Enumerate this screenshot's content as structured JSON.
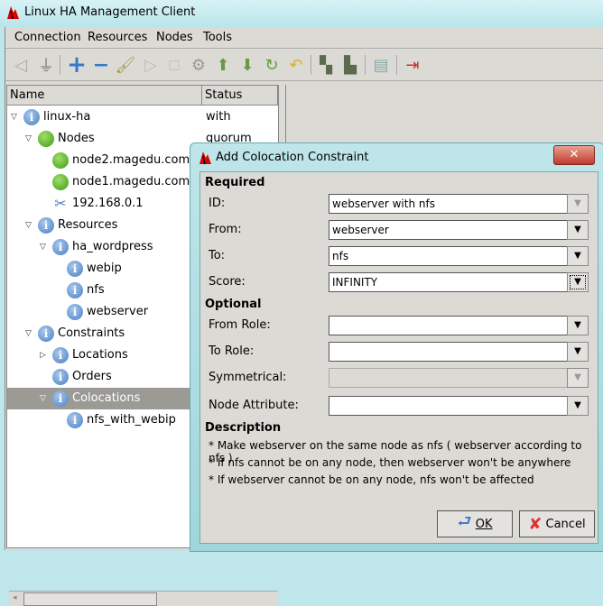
{
  "window": {
    "title": "Linux HA Management Client"
  },
  "menu": [
    "Connection",
    "Resources",
    "Nodes",
    "Tools"
  ],
  "toolbar": {
    "icons": [
      "connect-icon",
      "disconnect-icon",
      "add-icon",
      "remove-icon",
      "cleanup-icon",
      "start-icon",
      "stop-icon",
      "settings-icon",
      "up-icon",
      "down-icon",
      "redo-icon",
      "undo-icon",
      "standby-icon",
      "active-icon",
      "document-icon",
      "exit-icon"
    ]
  },
  "tree": {
    "columns": [
      "Name",
      "Status"
    ],
    "rows": [
      {
        "label": "linux-ha",
        "status": "with quorum",
        "icon": "info",
        "level": 0,
        "expander": "open"
      },
      {
        "label": "Nodes",
        "icon": "green",
        "level": 1,
        "expander": "open"
      },
      {
        "label": "node2.magedu.com",
        "icon": "green",
        "level": 2
      },
      {
        "label": "node1.magedu.com",
        "icon": "green",
        "level": 2
      },
      {
        "label": "192.168.0.1",
        "icon": "tool",
        "level": 2
      },
      {
        "label": "Resources",
        "icon": "info",
        "level": 1,
        "expander": "open"
      },
      {
        "label": "ha_wordpress",
        "icon": "info",
        "level": 2,
        "expander": "open"
      },
      {
        "label": "webip",
        "icon": "info",
        "level": 3
      },
      {
        "label": "nfs",
        "icon": "info",
        "level": 3
      },
      {
        "label": "webserver",
        "icon": "info",
        "level": 3
      },
      {
        "label": "Constraints",
        "icon": "info",
        "level": 1,
        "expander": "open"
      },
      {
        "label": "Locations",
        "icon": "info",
        "level": 2,
        "expander": "closed"
      },
      {
        "label": "Orders",
        "icon": "info",
        "level": 2
      },
      {
        "label": "Colocations",
        "icon": "info",
        "level": 2,
        "expander": "open",
        "selected": true
      },
      {
        "label": "nfs_with_webip",
        "icon": "info",
        "level": 3
      }
    ]
  },
  "dialog": {
    "title": "Add Colocation Constraint",
    "required_label": "Required",
    "optional_label": "Optional",
    "description_label": "Description",
    "fields": [
      {
        "label": "ID:",
        "value": "webserver with nfs"
      },
      {
        "label": "From:",
        "value": "webserver"
      },
      {
        "label": "To:",
        "value": "nfs"
      },
      {
        "label": "Score:",
        "value": "INFINITY"
      },
      {
        "label": "From Role:",
        "value": ""
      },
      {
        "label": "To Role:",
        "value": ""
      },
      {
        "label": "Symmetrical:",
        "value": ""
      },
      {
        "label": "Node Attribute:",
        "value": ""
      }
    ],
    "description": [
      "* Make webserver  on the same node as nfs   ( webserver according to nfs )",
      "* If nfs cannot be  on any node, then webserver won't be  anywhere",
      "* If webserver cannot be  on any node, nfs won't be affected"
    ],
    "ok_label": "OK",
    "cancel_label": "Cancel"
  }
}
